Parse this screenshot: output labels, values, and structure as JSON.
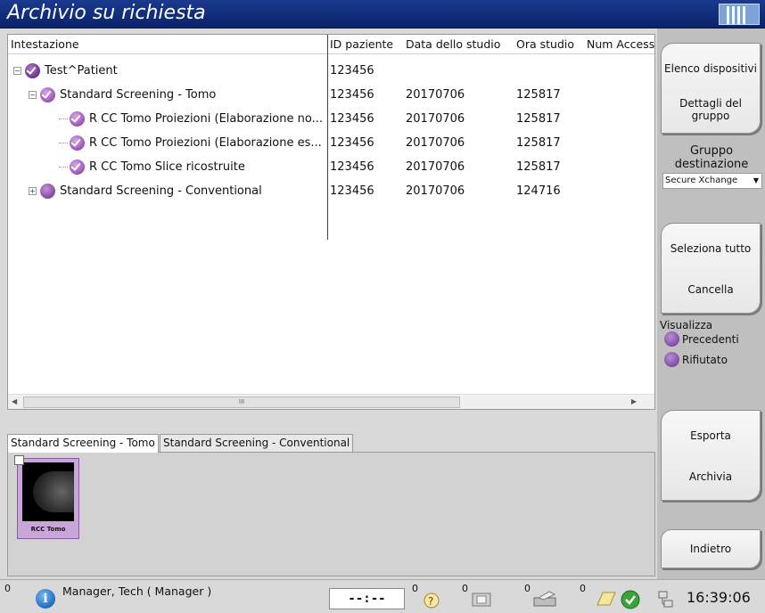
{
  "window": {
    "title": "Archivio su richiesta"
  },
  "grid": {
    "columns": [
      "Intestazione",
      "ID paziente",
      "Data dello studio",
      "Ora studio",
      "Num Access"
    ],
    "rows": [
      {
        "level": 0,
        "expander": "⊟",
        "badge": "dark-check",
        "label": "Test^Patient",
        "patient_id": "123456",
        "date": "",
        "time": ""
      },
      {
        "level": 1,
        "expander": "⊟",
        "badge": "check",
        "label": "Standard Screening - Tomo",
        "patient_id": "123456",
        "date": "20170706",
        "time": "125817"
      },
      {
        "level": 2,
        "expander": "",
        "badge": "check",
        "label": "R CC Tomo  Proiezioni (Elaborazione no...",
        "patient_id": "123456",
        "date": "20170706",
        "time": "125817"
      },
      {
        "level": 2,
        "expander": "",
        "badge": "check",
        "label": "R CC Tomo  Proiezioni (Elaborazione es...",
        "patient_id": "123456",
        "date": "20170706",
        "time": "125817"
      },
      {
        "level": 2,
        "expander": "",
        "badge": "check",
        "label": "R CC Tomo  Slice ricostruite",
        "patient_id": "123456",
        "date": "20170706",
        "time": "125817"
      },
      {
        "level": 1,
        "expander": "⊞",
        "badge": "plain",
        "label": "Standard Screening - Conventional",
        "patient_id": "123456",
        "date": "20170706",
        "time": "124716"
      }
    ],
    "scroll_thumb_text": "III"
  },
  "tabs": [
    "Standard Screening - Tomo",
    "Standard Screening - Conventional"
  ],
  "thumbnail": {
    "label": "RCC Tomo"
  },
  "right_panel": {
    "device_list": "Elenco dispositivi",
    "group_details": "Dettagli del gruppo",
    "destination_group": "Gruppo destinazione",
    "destination_value": "Secure Xchange",
    "select_all": "Seleziona tutto",
    "clear": "Cancella",
    "show_label": "Visualizza",
    "show_prior": "Precedenti",
    "show_rejected": "Rifiutato",
    "export": "Esporta",
    "archive": "Archivia",
    "back": "Indietro"
  },
  "status": {
    "count_left": "0",
    "user": "Manager, Tech ( Manager )",
    "clock": "--:--",
    "counts": [
      "0",
      "0",
      "0",
      "0"
    ],
    "time": "16:39:06",
    "icons": [
      "info-icon",
      "help-icon",
      "media-icon",
      "printer-icon",
      "notes-icon",
      "checkmark-icon",
      "network-icon"
    ]
  }
}
